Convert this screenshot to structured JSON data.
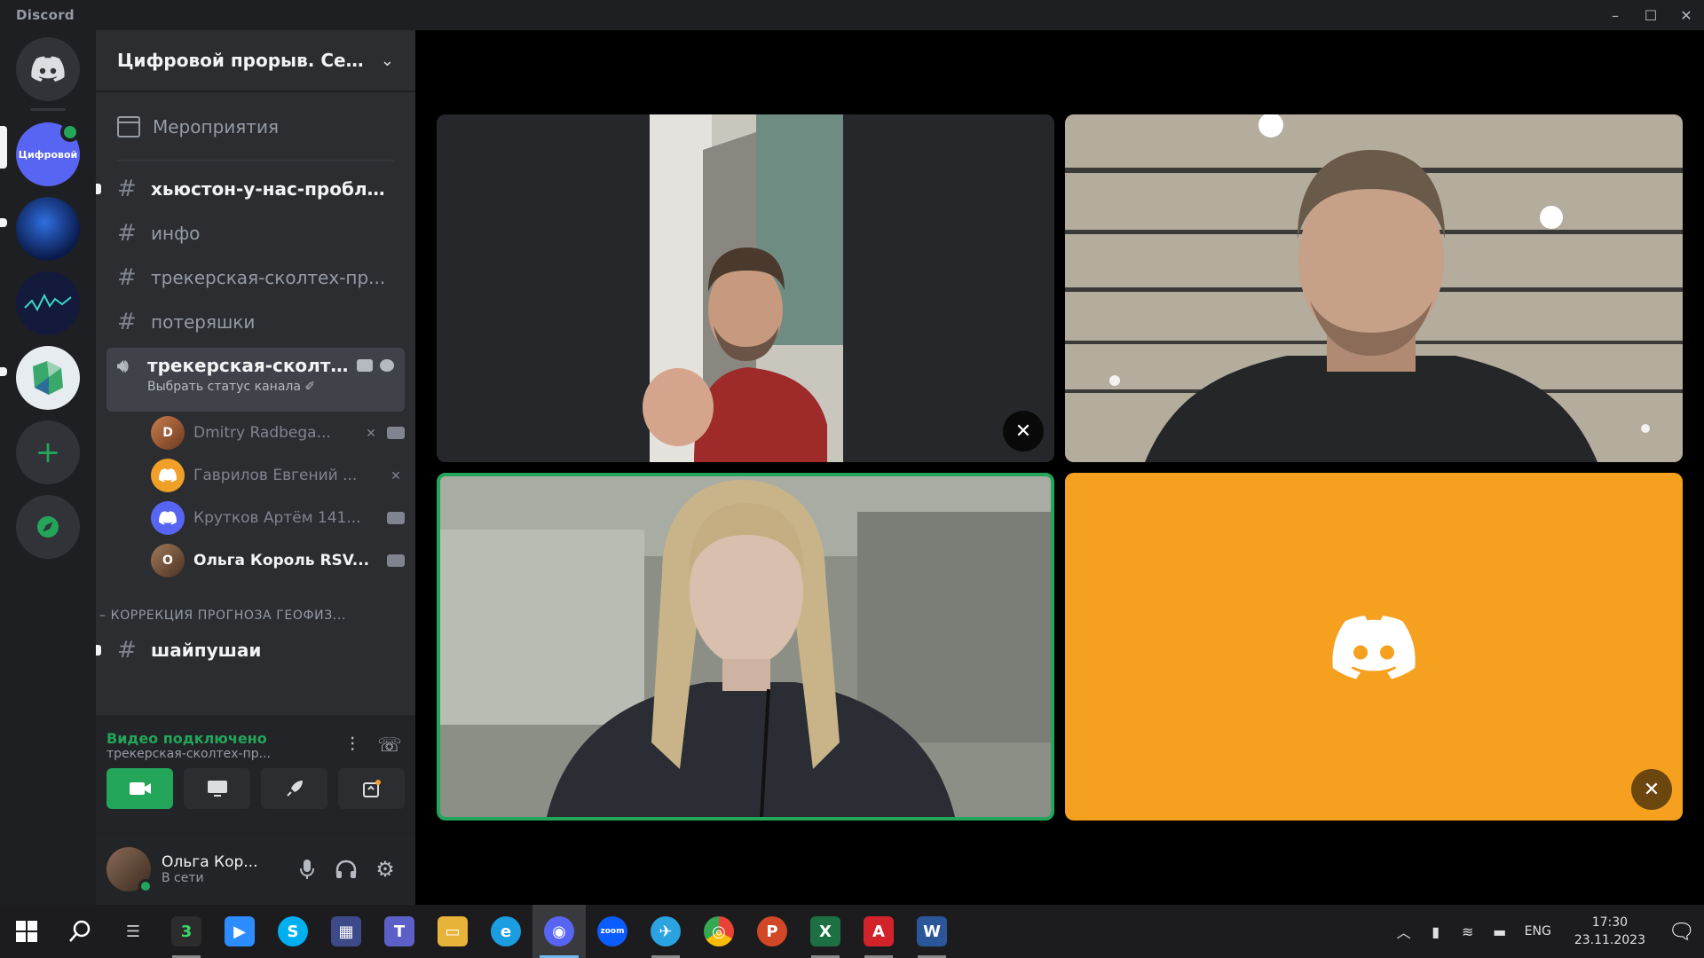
{
  "window": {
    "title": "Discord",
    "minimize": "–",
    "maximize": "☐",
    "close": "✕"
  },
  "servers": [
    {
      "name": "home",
      "color": "#36393f"
    },
    {
      "name": "server-1",
      "label": "Цифровой",
      "color": "#5865f2"
    },
    {
      "name": "server-2",
      "color": "#0d2a6b"
    },
    {
      "name": "server-3",
      "color": "#141a3c"
    },
    {
      "name": "server-4",
      "color": "#e6ecf0"
    }
  ],
  "server": {
    "name": "Цифровой прорыв. Сез..."
  },
  "sidebar": {
    "events_label": "Мероприятия",
    "text_channels": [
      {
        "name": "хьюстон-у-нас-пробле...",
        "unread": true
      },
      {
        "name": "инфо",
        "unread": false
      },
      {
        "name": "трекерская-сколтех-пр...",
        "unread": false
      },
      {
        "name": "потеряшки",
        "unread": false
      }
    ],
    "voice_channel": {
      "name": "трекерская-сколт...",
      "status": "Выбрать статус канала ✐"
    },
    "voice_users": [
      {
        "name": "Dmitry Radbega...",
        "color": "#c97b4a",
        "initials": "D",
        "active": false,
        "icons": [
          "mic-off",
          "cam"
        ]
      },
      {
        "name": "Гаврилов Евгений ...",
        "color": "#f0a028",
        "initials": "",
        "active": false,
        "icons": [
          "mic-off"
        ]
      },
      {
        "name": "Крутков Артём 141...",
        "color": "#5865f2",
        "initials": "",
        "active": false,
        "icons": [
          "cam"
        ]
      },
      {
        "name": "Ольга Король RSV...",
        "color": "#7a5640",
        "initials": "О",
        "active": true,
        "icons": [
          "cam"
        ]
      }
    ],
    "category_name": "– КОРРЕКЦИЯ ПРОГНОЗА ГЕОФИЗ...",
    "category_channel": "шайпушаи"
  },
  "rtc": {
    "status": "Видео подключено",
    "subtitle": "трекерская-сколтех-пр...",
    "icons": [
      "noise-suppression-icon",
      "disconnect-icon"
    ]
  },
  "rtc_buttons": [
    "video",
    "screen-share",
    "activity",
    "soundboard"
  ],
  "user": {
    "name": "Ольга Кор...",
    "status": "В сети"
  },
  "taskbar": {
    "apps": [
      {
        "name": "start",
        "label": "⊞",
        "color": "#1c1c1e"
      },
      {
        "name": "search",
        "label": "⌕",
        "color": "#1c1c1e"
      },
      {
        "name": "task-view",
        "label": "☰",
        "color": "#1c1c1e"
      },
      {
        "name": "app-3",
        "label": "3",
        "color": "#2c2c2c"
      },
      {
        "name": "zoom",
        "label": "▶",
        "color": "#2d8cff"
      },
      {
        "name": "skype",
        "label": "S",
        "color": "#00aff0"
      },
      {
        "name": "calculator",
        "label": "▦",
        "color": "#3c4a8a"
      },
      {
        "name": "teams",
        "label": "T",
        "color": "#5b5fc7"
      },
      {
        "name": "explorer",
        "label": "▭",
        "color": "#e8b339"
      },
      {
        "name": "edge",
        "label": "e",
        "color": "#1b9de2"
      },
      {
        "name": "discord",
        "label": "◉",
        "color": "#5865f2",
        "active": true
      },
      {
        "name": "zoom-2",
        "label": "zoom",
        "color": "#0b5cff"
      },
      {
        "name": "telegram",
        "label": "✈",
        "color": "#2aa3e0"
      },
      {
        "name": "chrome",
        "label": "◎",
        "color": "#34a853"
      },
      {
        "name": "powerpoint",
        "label": "P",
        "color": "#d24726"
      },
      {
        "name": "excel",
        "label": "X",
        "color": "#1d7044"
      },
      {
        "name": "acrobat",
        "label": "A",
        "color": "#d2232a"
      },
      {
        "name": "word",
        "label": "W",
        "color": "#2b579a"
      }
    ],
    "lang": "ENG",
    "time": "17:30",
    "date": "23.11.2023"
  },
  "colors": {
    "accent_green": "#23a55a",
    "tile_orange": "#f5a11f",
    "blurple": "#5865f2"
  }
}
